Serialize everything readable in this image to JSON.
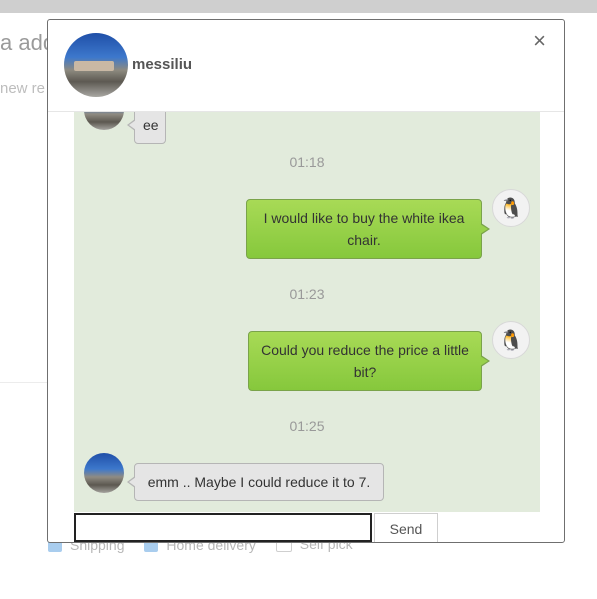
{
  "background": {
    "heading_fragment": "a add",
    "subtext_fragment": "new re",
    "options": [
      "Shipping",
      "Home delivery",
      "Self pick"
    ]
  },
  "chat": {
    "contact_name": "messiliu",
    "close_label": "×",
    "messages": [
      {
        "side": "left",
        "text": "ee"
      },
      {
        "time": "01:18"
      },
      {
        "side": "right",
        "text": "I would like to buy the white ikea chair."
      },
      {
        "time": "01:23"
      },
      {
        "side": "right",
        "text": "Could you reduce the price a little bit?"
      },
      {
        "time": "01:25"
      },
      {
        "side": "left",
        "text": "emm .. Maybe I could reduce it to 7."
      }
    ],
    "input_value": "",
    "send_label": "Send"
  },
  "icons": {
    "self_avatar": "penguin-avatar-icon",
    "friend_avatar": "landscape-avatar-icon",
    "close": "close-icon"
  },
  "colors": {
    "chat_background": "#e2ebdc",
    "sent_bubble": "#98d14b",
    "received_bubble": "#e5e5e5"
  }
}
